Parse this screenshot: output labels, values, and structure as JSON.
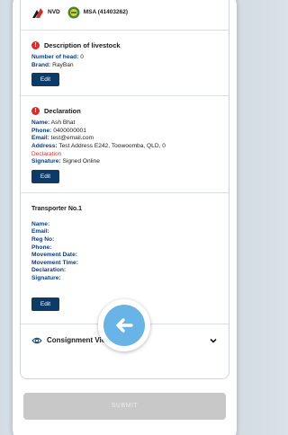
{
  "header": {
    "nvd_label": "NVD",
    "msa_label": "MSA (41403262)"
  },
  "livestock": {
    "title": "Description of livestock",
    "fields": [
      {
        "label": "Number of head:",
        "value": "0"
      },
      {
        "label": "Brand:",
        "value": "RayBan"
      }
    ],
    "edit_label": "Edit"
  },
  "declaration": {
    "title": "Declaration",
    "fields": [
      {
        "label": "Name:",
        "value": "Ash Bhat"
      },
      {
        "label": "Phone:",
        "value": "0400000001"
      },
      {
        "label": "Email:",
        "value": "test@email.com"
      },
      {
        "label": "Address:",
        "value": "Test Address E242, Toowoomba, QLD, 0"
      }
    ],
    "declaration_text": "Declaration",
    "signature_label": "Signature:",
    "signature_value": "Signed Online",
    "edit_label": "Edit"
  },
  "transporter": {
    "title": "Transporter No.1",
    "labels": [
      "Name:",
      "Email:",
      "Reg No:",
      "Phone:",
      "Movement Date:",
      "Movement Time:",
      "Declaration:",
      "Signature:"
    ],
    "edit_label": "Edit"
  },
  "viewers": {
    "label": "Consignment Viewers (0)"
  },
  "submit_label": "SUBMIT",
  "colors": {
    "primary_button": "#0d3b66",
    "label_blue": "#103d75",
    "alert_red": "#d32f2f",
    "disabled_button": "#c8c8c8",
    "cursor_blue": "#6ab3e6"
  }
}
